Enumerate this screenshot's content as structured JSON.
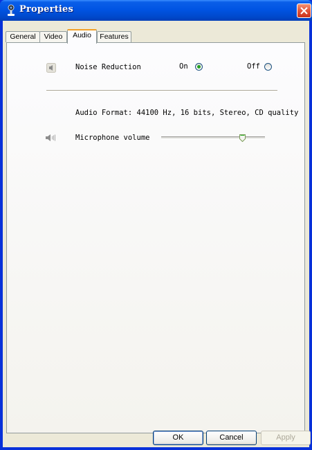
{
  "window": {
    "title": "Properties",
    "accent_color": "#0054e3",
    "close_color": "#e2553a"
  },
  "tabs": [
    {
      "label": "General",
      "active": false
    },
    {
      "label": "Video",
      "active": false
    },
    {
      "label": "Audio",
      "active": true
    },
    {
      "label": "Features",
      "active": false
    }
  ],
  "audio": {
    "noise_reduction": {
      "label": "Noise Reduction",
      "on_label": "On",
      "off_label": "Off",
      "selected": "On",
      "icon": "speaker-icon"
    },
    "format_text": "Audio Format: 44100 Hz, 16 bits, Stereo, CD quality",
    "microphone": {
      "label": "Microphone volume",
      "icon": "volume-icon",
      "level": 0.8
    }
  },
  "buttons": {
    "ok": "OK",
    "cancel": "Cancel",
    "apply": "Apply"
  }
}
